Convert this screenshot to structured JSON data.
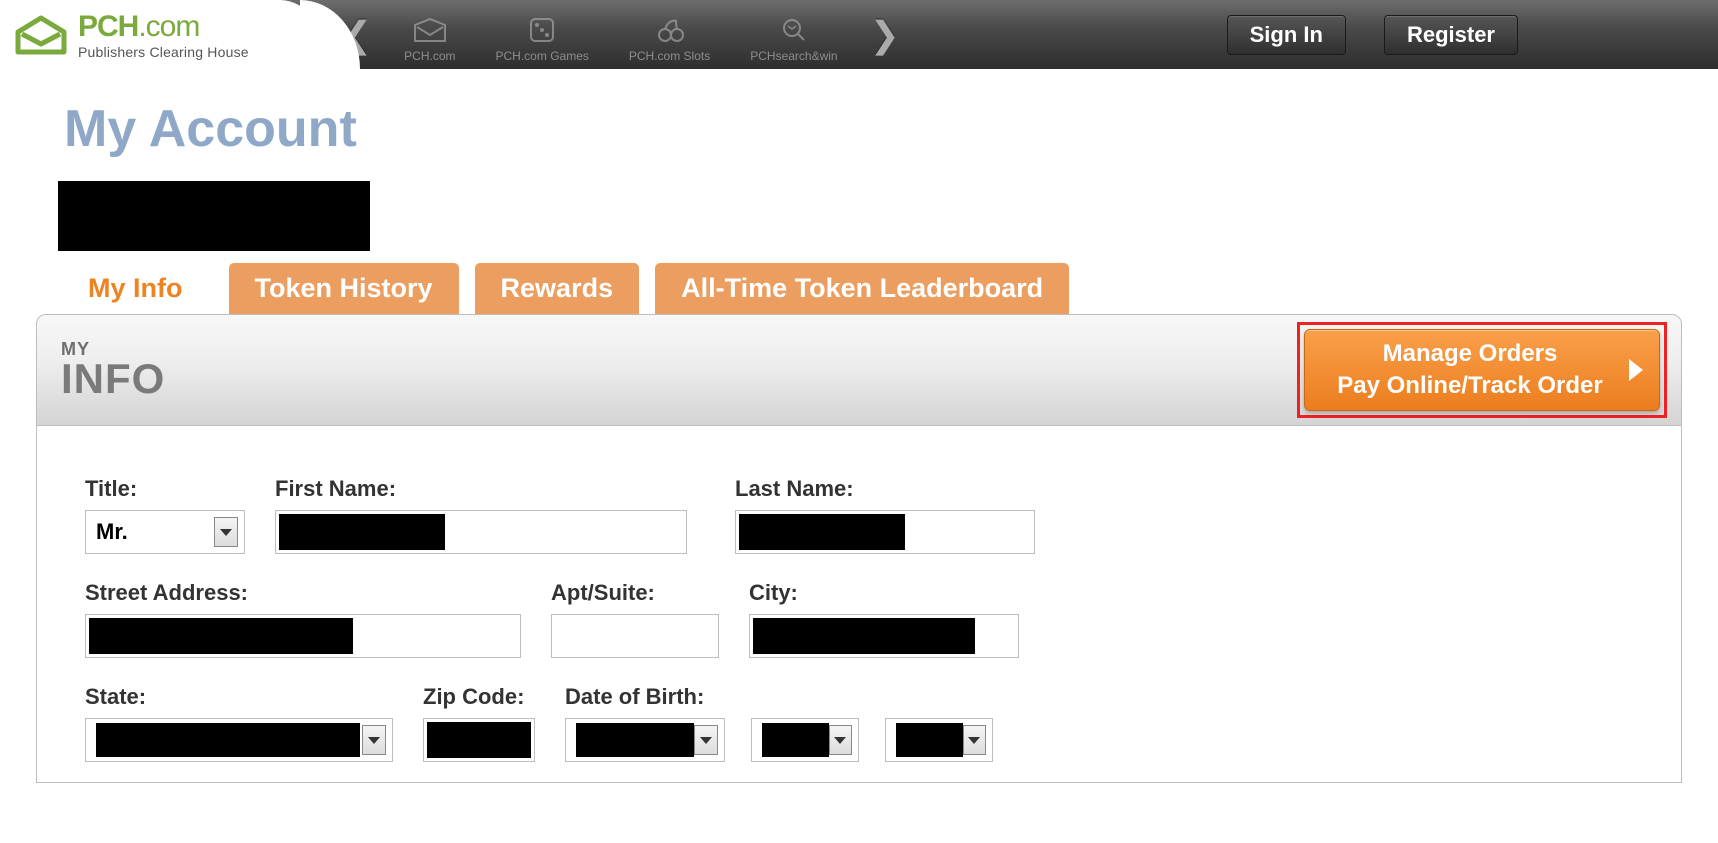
{
  "brand": {
    "name": "PCH.com",
    "tagline": "Publishers Clearing House"
  },
  "topnav": {
    "items": [
      {
        "label": "PCH.com"
      },
      {
        "label": "PCH.com Games"
      },
      {
        "label": "PCH.com Slots"
      },
      {
        "label": "PCHsearch&win"
      }
    ]
  },
  "auth": {
    "signin": "Sign In",
    "register": "Register"
  },
  "page_title": "My Account",
  "tabs": [
    {
      "label": "My Info",
      "active": true
    },
    {
      "label": "Token History",
      "active": false
    },
    {
      "label": "Rewards",
      "active": false
    },
    {
      "label": "All-Time Token Leaderboard",
      "active": false
    }
  ],
  "panel": {
    "heading_small": "MY",
    "heading_big": "INFO",
    "manage_orders_line1": "Manage Orders",
    "manage_orders_line2": "Pay Online/Track Order"
  },
  "form": {
    "title_label": "Title:",
    "title_value": "Mr.",
    "first_name_label": "First Name:",
    "last_name_label": "Last Name:",
    "street_label": "Street Address:",
    "apt_label": "Apt/Suite:",
    "city_label": "City:",
    "state_label": "State:",
    "zip_label": "Zip Code:",
    "dob_label": "Date of Birth:"
  }
}
